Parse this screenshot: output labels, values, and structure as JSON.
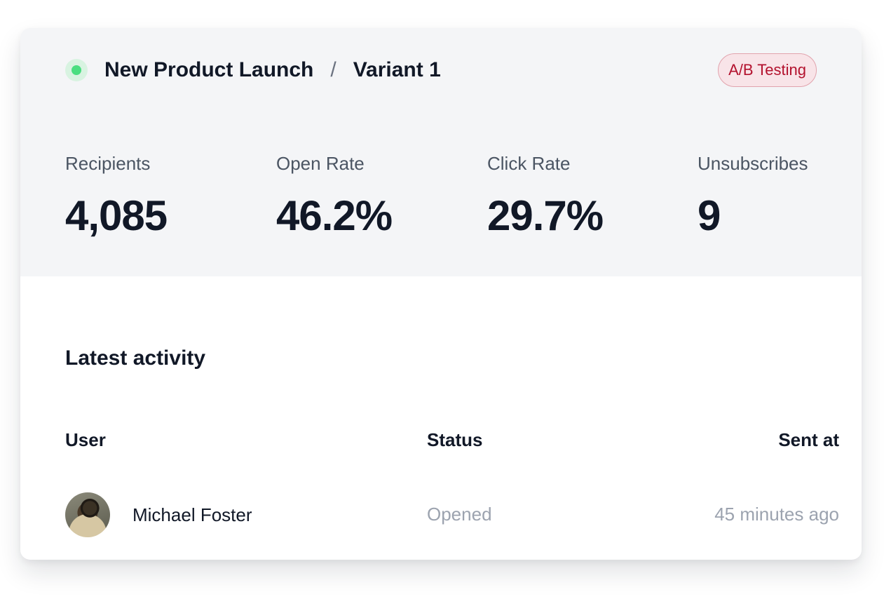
{
  "campaign": {
    "status_color": "#4ade80",
    "name": "New Product Launch",
    "separator": "/",
    "variant": "Variant 1",
    "badge": "A/B Testing"
  },
  "stats": [
    {
      "label": "Recipients",
      "value": "4,085"
    },
    {
      "label": "Open Rate",
      "value": "46.2%"
    },
    {
      "label": "Click Rate",
      "value": "29.7%"
    },
    {
      "label": "Unsubscribes",
      "value": "9"
    }
  ],
  "activity": {
    "title": "Latest activity",
    "columns": {
      "user": "User",
      "status": "Status",
      "sent_at": "Sent at"
    },
    "rows": [
      {
        "user": "Michael Foster",
        "status": "Opened",
        "sent_at": "45 minutes ago"
      }
    ]
  }
}
